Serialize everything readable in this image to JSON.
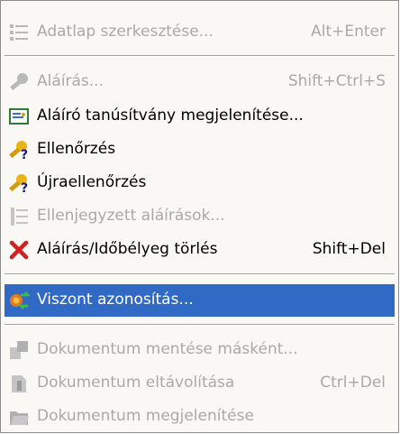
{
  "menu": {
    "items": [
      {
        "label": "Adatlap szerkesztése...",
        "shortcut": "Alt+Enter",
        "icon": "list-edit-icon"
      },
      {
        "label": "Aláírás...",
        "shortcut": "Shift+Ctrl+S",
        "icon": "key-icon"
      },
      {
        "label": "Aláíró tanúsítvány megjelenítése...",
        "shortcut": "",
        "icon": "certificate-icon"
      },
      {
        "label": "Ellenőrzés",
        "shortcut": "",
        "icon": "key-question-icon"
      },
      {
        "label": "Újraellenőrzés",
        "shortcut": "",
        "icon": "key-question-icon"
      },
      {
        "label": "Ellenjegyzett aláírások...",
        "shortcut": "",
        "icon": "list-icon"
      },
      {
        "label": "Aláírás/Időbélyeg törlés",
        "shortcut": "Shift+Del",
        "icon": "delete-x-icon"
      },
      {
        "label": "Viszont azonosítás...",
        "shortcut": "",
        "icon": "verify-exchange-icon"
      },
      {
        "label": "Dokumentum mentése másként...",
        "shortcut": "",
        "icon": "save-as-icon"
      },
      {
        "label": "Dokumentum eltávolítása",
        "shortcut": "Ctrl+Del",
        "icon": "document-remove-icon"
      },
      {
        "label": "Dokumentum megjelenítése",
        "shortcut": "",
        "icon": "folder-open-icon"
      }
    ]
  }
}
